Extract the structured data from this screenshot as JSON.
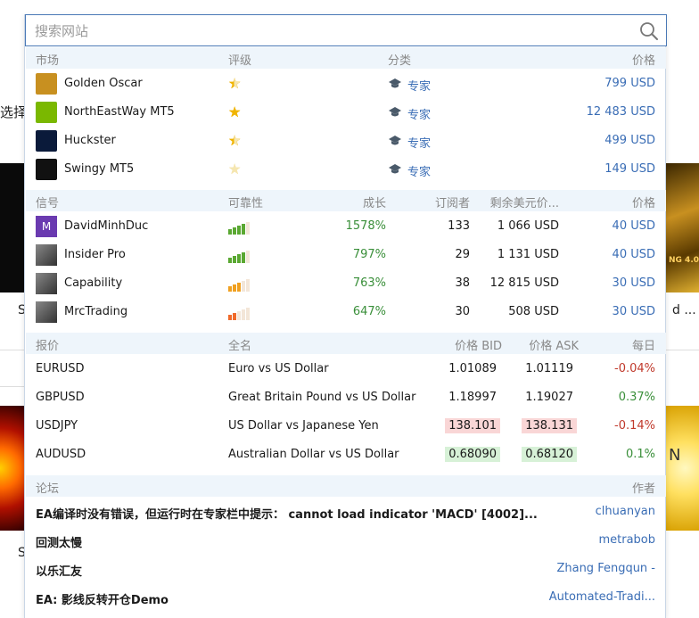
{
  "background": {
    "left_text": "选择匪",
    "left_snippet_1": "S",
    "left_snippet_2": "S",
    "right_snippet_1": "d ...",
    "right_image_text": "NG 4.0",
    "right_image_text_2": "N"
  },
  "search": {
    "placeholder": "搜索网站"
  },
  "market": {
    "header": {
      "col1": "市场",
      "col2": "评级",
      "col3": "分类",
      "col4": "价格"
    },
    "items": [
      {
        "name": "Golden Oscar",
        "rating": 4.5,
        "category": "专家",
        "price": "799 USD",
        "icon_color": "#c89020"
      },
      {
        "name": "NorthEastWay MT5",
        "rating": 5,
        "category": "专家",
        "price": "12 483 USD",
        "icon_color": "#7ab800"
      },
      {
        "name": "Huckster",
        "rating": 4.5,
        "category": "专家",
        "price": "499 USD",
        "icon_color": "#0a1a3a"
      },
      {
        "name": "Swingy MT5",
        "rating": 0,
        "category": "专家",
        "price": "149 USD",
        "icon_color": "#111111"
      }
    ]
  },
  "signals": {
    "header": {
      "col1": "信号",
      "col2": "可靠性",
      "col3": "成长",
      "col4": "订阅者",
      "col5": "剩余美元价...",
      "col6": "价格"
    },
    "items": [
      {
        "name": "DavidMinhDuc",
        "reliability": "green",
        "growth": "1578%",
        "subscribers": "133",
        "remaining": "1 066 USD",
        "price": "40 USD",
        "avatar_letter": "M"
      },
      {
        "name": "Insider Pro",
        "reliability": "green",
        "growth": "797%",
        "subscribers": "29",
        "remaining": "1 131 USD",
        "price": "40 USD",
        "avatar_letter": ""
      },
      {
        "name": "Capability",
        "reliability": "orange",
        "growth": "763%",
        "subscribers": "38",
        "remaining": "12 815 USD",
        "price": "30 USD",
        "avatar_letter": ""
      },
      {
        "name": "MrcTrading",
        "reliability": "red",
        "growth": "647%",
        "subscribers": "30",
        "remaining": "508 USD",
        "price": "30 USD",
        "avatar_letter": ""
      }
    ]
  },
  "quotes": {
    "header": {
      "col1": "报价",
      "col2": "全名",
      "col3": "价格 BID",
      "col4": "价格 ASK",
      "col5": "每日"
    },
    "items": [
      {
        "symbol": "EURUSD",
        "full_name": "Euro vs US Dollar",
        "bid": "1.01089",
        "ask": "1.01119",
        "daily": "-0.04%",
        "highlight": "none",
        "direction": "down"
      },
      {
        "symbol": "GBPUSD",
        "full_name": "Great Britain Pound vs US Dollar",
        "bid": "1.18997",
        "ask": "1.19027",
        "daily": "0.37%",
        "highlight": "none",
        "direction": "up"
      },
      {
        "symbol": "USDJPY",
        "full_name": "US Dollar vs Japanese Yen",
        "bid": "138.101",
        "ask": "138.131",
        "daily": "-0.14%",
        "highlight": "down",
        "direction": "down"
      },
      {
        "symbol": "AUDUSD",
        "full_name": "Australian Dollar vs US Dollar",
        "bid": "0.68090",
        "ask": "0.68120",
        "daily": "0.1%",
        "highlight": "up",
        "direction": "up"
      }
    ]
  },
  "forum": {
    "header": {
      "col1": "论坛",
      "col2": "作者"
    },
    "items": [
      {
        "topic": "EA编译时没有错误，但运行时在专家栏中提示： cannot load indicator 'MACD' [4002]...",
        "author": "clhuanyan"
      },
      {
        "topic": "回测太慢",
        "author": "metrabob"
      },
      {
        "topic": "以乐汇友",
        "author": "Zhang Fengqun -"
      },
      {
        "topic": "EA: 影线反转开仓Demo",
        "author": "Automated-Tradi..."
      }
    ]
  },
  "colors": {
    "link": "#3a6db5",
    "positive": "#3a8f3a",
    "negative": "#c0392b",
    "header_bg": "#eef5fb",
    "star": "#f0b400"
  }
}
